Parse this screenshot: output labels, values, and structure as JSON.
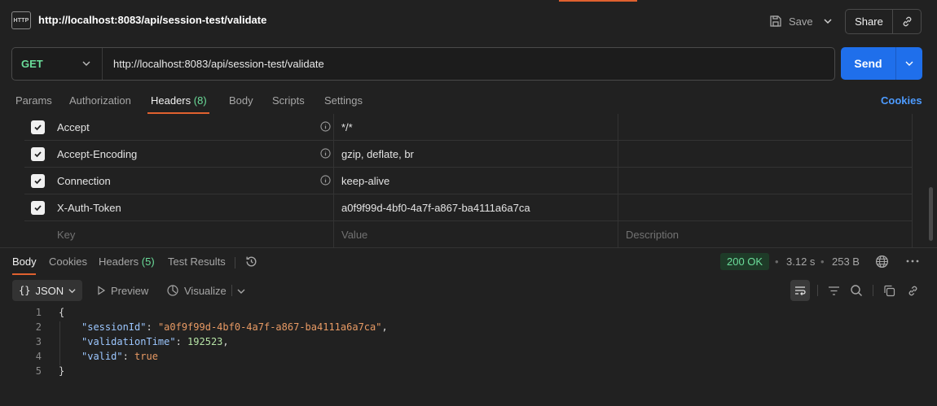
{
  "window": {
    "title": "http://localhost:8083/api/session-test/validate"
  },
  "topbar": {
    "icon": "http-icon",
    "icon_text": "HTTP",
    "save_label": "Save",
    "share_label": "Share"
  },
  "request": {
    "method": "GET",
    "url": "http://localhost:8083/api/session-test/validate",
    "send_label": "Send"
  },
  "tabs": {
    "params": "Params",
    "authorization": "Authorization",
    "headers": "Headers",
    "headers_count": "(8)",
    "body": "Body",
    "scripts": "Scripts",
    "settings": "Settings",
    "cookies": "Cookies"
  },
  "headers": [
    {
      "key": "Accept",
      "value": "*/*",
      "checked": true,
      "info": true
    },
    {
      "key": "Accept-Encoding",
      "value": "gzip, deflate, br",
      "checked": true,
      "info": true
    },
    {
      "key": "Connection",
      "value": "keep-alive",
      "checked": true,
      "info": true
    },
    {
      "key": "X-Auth-Token",
      "value": "a0f9f99d-4bf0-4a7f-a867-ba4111a6a7ca",
      "checked": true,
      "info": false
    }
  ],
  "headers_placeholder": {
    "key": "Key",
    "value": "Value",
    "description": "Description"
  },
  "response": {
    "tabs": {
      "body": "Body",
      "cookies": "Cookies",
      "headers": "Headers",
      "headers_count": "(5)",
      "test_results": "Test Results"
    },
    "status": "200 OK",
    "time": "3.12 s",
    "size": "253 B",
    "format": "JSON",
    "preview": "Preview",
    "visualize": "Visualize",
    "lines": [
      {
        "n": "1",
        "text": "{"
      },
      {
        "n": "2",
        "key": "\"sessionId\"",
        "value": "\"a0f9f99d-4bf0-4a7f-a867-ba4111a6a7ca\"",
        "type": "string",
        "trail": ","
      },
      {
        "n": "3",
        "key": "\"validationTime\"",
        "value": "192523",
        "type": "number",
        "trail": ","
      },
      {
        "n": "4",
        "key": "\"valid\"",
        "value": "true",
        "type": "bool",
        "trail": ""
      },
      {
        "n": "5",
        "text": "}"
      }
    ]
  },
  "colors": {
    "accent": "#e0612f",
    "send": "#1f6feb",
    "method": "#6bdd9a",
    "link": "#4d9bff"
  }
}
